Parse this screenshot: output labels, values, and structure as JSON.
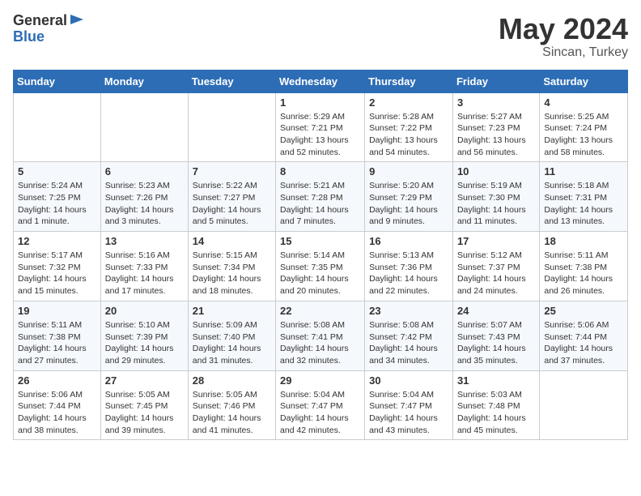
{
  "logo": {
    "general": "General",
    "blue": "Blue"
  },
  "title": "May 2024",
  "subtitle": "Sincan, Turkey",
  "days_of_week": [
    "Sunday",
    "Monday",
    "Tuesday",
    "Wednesday",
    "Thursday",
    "Friday",
    "Saturday"
  ],
  "weeks": [
    [
      {
        "num": "",
        "sunrise": "",
        "sunset": "",
        "daylight": ""
      },
      {
        "num": "",
        "sunrise": "",
        "sunset": "",
        "daylight": ""
      },
      {
        "num": "",
        "sunrise": "",
        "sunset": "",
        "daylight": ""
      },
      {
        "num": "1",
        "sunrise": "Sunrise: 5:29 AM",
        "sunset": "Sunset: 7:21 PM",
        "daylight": "Daylight: 13 hours and 52 minutes."
      },
      {
        "num": "2",
        "sunrise": "Sunrise: 5:28 AM",
        "sunset": "Sunset: 7:22 PM",
        "daylight": "Daylight: 13 hours and 54 minutes."
      },
      {
        "num": "3",
        "sunrise": "Sunrise: 5:27 AM",
        "sunset": "Sunset: 7:23 PM",
        "daylight": "Daylight: 13 hours and 56 minutes."
      },
      {
        "num": "4",
        "sunrise": "Sunrise: 5:25 AM",
        "sunset": "Sunset: 7:24 PM",
        "daylight": "Daylight: 13 hours and 58 minutes."
      }
    ],
    [
      {
        "num": "5",
        "sunrise": "Sunrise: 5:24 AM",
        "sunset": "Sunset: 7:25 PM",
        "daylight": "Daylight: 14 hours and 1 minute."
      },
      {
        "num": "6",
        "sunrise": "Sunrise: 5:23 AM",
        "sunset": "Sunset: 7:26 PM",
        "daylight": "Daylight: 14 hours and 3 minutes."
      },
      {
        "num": "7",
        "sunrise": "Sunrise: 5:22 AM",
        "sunset": "Sunset: 7:27 PM",
        "daylight": "Daylight: 14 hours and 5 minutes."
      },
      {
        "num": "8",
        "sunrise": "Sunrise: 5:21 AM",
        "sunset": "Sunset: 7:28 PM",
        "daylight": "Daylight: 14 hours and 7 minutes."
      },
      {
        "num": "9",
        "sunrise": "Sunrise: 5:20 AM",
        "sunset": "Sunset: 7:29 PM",
        "daylight": "Daylight: 14 hours and 9 minutes."
      },
      {
        "num": "10",
        "sunrise": "Sunrise: 5:19 AM",
        "sunset": "Sunset: 7:30 PM",
        "daylight": "Daylight: 14 hours and 11 minutes."
      },
      {
        "num": "11",
        "sunrise": "Sunrise: 5:18 AM",
        "sunset": "Sunset: 7:31 PM",
        "daylight": "Daylight: 14 hours and 13 minutes."
      }
    ],
    [
      {
        "num": "12",
        "sunrise": "Sunrise: 5:17 AM",
        "sunset": "Sunset: 7:32 PM",
        "daylight": "Daylight: 14 hours and 15 minutes."
      },
      {
        "num": "13",
        "sunrise": "Sunrise: 5:16 AM",
        "sunset": "Sunset: 7:33 PM",
        "daylight": "Daylight: 14 hours and 17 minutes."
      },
      {
        "num": "14",
        "sunrise": "Sunrise: 5:15 AM",
        "sunset": "Sunset: 7:34 PM",
        "daylight": "Daylight: 14 hours and 18 minutes."
      },
      {
        "num": "15",
        "sunrise": "Sunrise: 5:14 AM",
        "sunset": "Sunset: 7:35 PM",
        "daylight": "Daylight: 14 hours and 20 minutes."
      },
      {
        "num": "16",
        "sunrise": "Sunrise: 5:13 AM",
        "sunset": "Sunset: 7:36 PM",
        "daylight": "Daylight: 14 hours and 22 minutes."
      },
      {
        "num": "17",
        "sunrise": "Sunrise: 5:12 AM",
        "sunset": "Sunset: 7:37 PM",
        "daylight": "Daylight: 14 hours and 24 minutes."
      },
      {
        "num": "18",
        "sunrise": "Sunrise: 5:11 AM",
        "sunset": "Sunset: 7:38 PM",
        "daylight": "Daylight: 14 hours and 26 minutes."
      }
    ],
    [
      {
        "num": "19",
        "sunrise": "Sunrise: 5:11 AM",
        "sunset": "Sunset: 7:38 PM",
        "daylight": "Daylight: 14 hours and 27 minutes."
      },
      {
        "num": "20",
        "sunrise": "Sunrise: 5:10 AM",
        "sunset": "Sunset: 7:39 PM",
        "daylight": "Daylight: 14 hours and 29 minutes."
      },
      {
        "num": "21",
        "sunrise": "Sunrise: 5:09 AM",
        "sunset": "Sunset: 7:40 PM",
        "daylight": "Daylight: 14 hours and 31 minutes."
      },
      {
        "num": "22",
        "sunrise": "Sunrise: 5:08 AM",
        "sunset": "Sunset: 7:41 PM",
        "daylight": "Daylight: 14 hours and 32 minutes."
      },
      {
        "num": "23",
        "sunrise": "Sunrise: 5:08 AM",
        "sunset": "Sunset: 7:42 PM",
        "daylight": "Daylight: 14 hours and 34 minutes."
      },
      {
        "num": "24",
        "sunrise": "Sunrise: 5:07 AM",
        "sunset": "Sunset: 7:43 PM",
        "daylight": "Daylight: 14 hours and 35 minutes."
      },
      {
        "num": "25",
        "sunrise": "Sunrise: 5:06 AM",
        "sunset": "Sunset: 7:44 PM",
        "daylight": "Daylight: 14 hours and 37 minutes."
      }
    ],
    [
      {
        "num": "26",
        "sunrise": "Sunrise: 5:06 AM",
        "sunset": "Sunset: 7:44 PM",
        "daylight": "Daylight: 14 hours and 38 minutes."
      },
      {
        "num": "27",
        "sunrise": "Sunrise: 5:05 AM",
        "sunset": "Sunset: 7:45 PM",
        "daylight": "Daylight: 14 hours and 39 minutes."
      },
      {
        "num": "28",
        "sunrise": "Sunrise: 5:05 AM",
        "sunset": "Sunset: 7:46 PM",
        "daylight": "Daylight: 14 hours and 41 minutes."
      },
      {
        "num": "29",
        "sunrise": "Sunrise: 5:04 AM",
        "sunset": "Sunset: 7:47 PM",
        "daylight": "Daylight: 14 hours and 42 minutes."
      },
      {
        "num": "30",
        "sunrise": "Sunrise: 5:04 AM",
        "sunset": "Sunset: 7:47 PM",
        "daylight": "Daylight: 14 hours and 43 minutes."
      },
      {
        "num": "31",
        "sunrise": "Sunrise: 5:03 AM",
        "sunset": "Sunset: 7:48 PM",
        "daylight": "Daylight: 14 hours and 45 minutes."
      },
      {
        "num": "",
        "sunrise": "",
        "sunset": "",
        "daylight": ""
      }
    ]
  ]
}
